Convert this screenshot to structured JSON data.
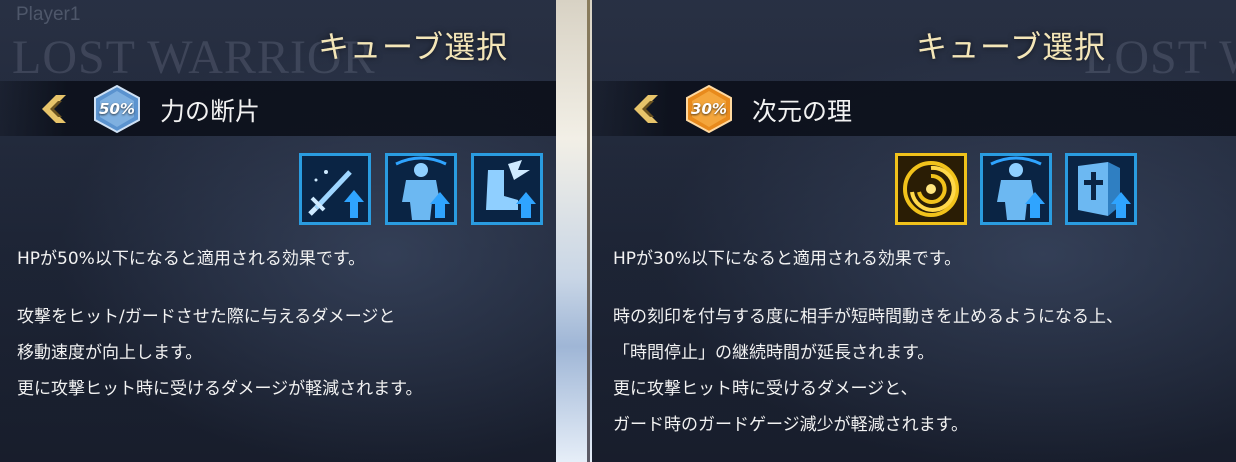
{
  "left": {
    "bg_player": "Player1",
    "bg_title": "LOST WARRIOR",
    "panel_title": "キューブ選択",
    "rate": "50%",
    "cube_name": "力の断片",
    "icons": [
      "sword-up-icon",
      "body-up-icon",
      "foot-up-icon"
    ],
    "description": {
      "condition": "HPが50%以下になると適用される効果です。",
      "lines": [
        "攻撃をヒット/ガードさせた際に与えるダメージと",
        "移動速度が向上します。",
        "更に攻撃ヒット時に受けるダメージが軽減されます。"
      ]
    }
  },
  "right": {
    "bg_title": "LOST W",
    "panel_title": "キューブ選択",
    "rate": "30%",
    "cube_name": "次元の理",
    "icons": [
      "vortex-icon",
      "body-up-icon",
      "shield-up-icon"
    ],
    "description": {
      "condition": "HPが30%以下になると適用される効果です。",
      "lines": [
        "時の刻印を付与する度に相手が短時間動きを止めるようになる上、",
        "「時間停止」の継続時間が延長されます。",
        "更に攻撃ヒット時に受けるダメージと、",
        "ガード時のガードゲージ減少が軽減されます。"
      ]
    }
  },
  "colors": {
    "title_gold": "#f4e6b8",
    "icon_blue": "#2a9ce0",
    "icon_gold": "#f1c21b",
    "hex_blue": "#5b93cf",
    "hex_orange": "#e88a1c"
  }
}
